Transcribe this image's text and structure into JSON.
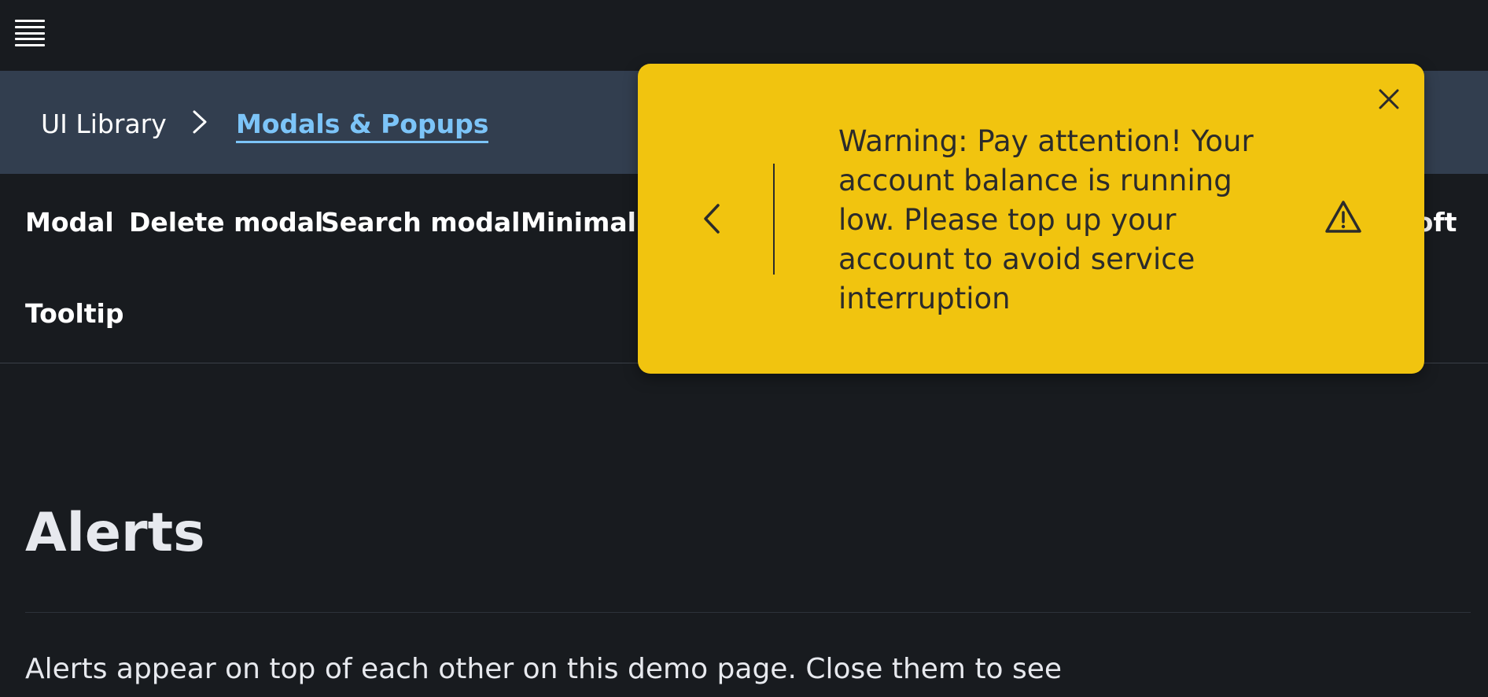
{
  "topbar": {
    "menu_icon": "hamburger-menu-icon"
  },
  "breadcrumb": {
    "root_label": "UI Library",
    "separator_icon": "chevron-right-icon",
    "current_label": "Modals & Popups"
  },
  "tabs": [
    {
      "label": "Modal"
    },
    {
      "label": "Delete modal"
    },
    {
      "label": "Search modal"
    },
    {
      "label": "Minimal m"
    },
    {
      "label": "soft"
    },
    {
      "label": "Tooltip"
    }
  ],
  "main": {
    "title": "Alerts",
    "intro": "Alerts appear on top of each other on this demo page. Close them to see"
  },
  "alert": {
    "type": "warning",
    "message": "Warning: Pay attention! Your account balance is running low. Please top up your account to avoid service interruption",
    "prev_icon": "chevron-left-icon",
    "status_icon": "warning-triangle-icon",
    "close_icon": "close-icon"
  },
  "colors": {
    "background": "#181b1f",
    "breadcrumb_bg": "#323e4f",
    "link": "#7cc4f8",
    "alert_bg": "#f1c40f",
    "alert_text": "#2b2b2b"
  }
}
